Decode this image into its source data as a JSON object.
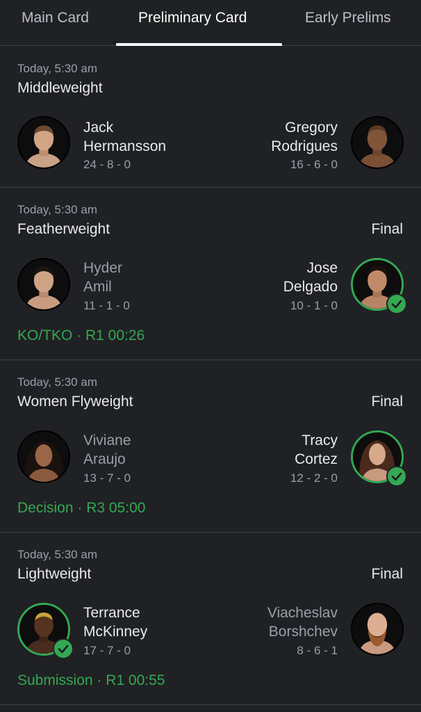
{
  "tabs": [
    {
      "label": "Main Card"
    },
    {
      "label": "Preliminary Card"
    },
    {
      "label": "Early Prelims"
    }
  ],
  "fights": [
    {
      "time": "Today, 5:30 am",
      "division": "Middleweight",
      "status": "",
      "left": {
        "first": "Jack",
        "last": "Hermansson",
        "record": "24 - 8 - 0",
        "winner": false
      },
      "right": {
        "first": "Gregory",
        "last": "Rodrigues",
        "record": "16 - 6 - 0",
        "winner": false
      },
      "result": ""
    },
    {
      "time": "Today, 5:30 am",
      "division": "Featherweight",
      "status": "Final",
      "left": {
        "first": "Hyder",
        "last": "Amil",
        "record": "11 - 1 - 0",
        "winner": false
      },
      "right": {
        "first": "Jose",
        "last": "Delgado",
        "record": "10 - 1 - 0",
        "winner": true
      },
      "result": "KO/TKO · R1 00:26"
    },
    {
      "time": "Today, 5:30 am",
      "division": "Women Flyweight",
      "status": "Final",
      "left": {
        "first": "Viviane",
        "last": "Araujo",
        "record": "13 - 7 - 0",
        "winner": false
      },
      "right": {
        "first": "Tracy",
        "last": "Cortez",
        "record": "12 - 2 - 0",
        "winner": true
      },
      "result": "Decision · R3 05:00"
    },
    {
      "time": "Today, 5:30 am",
      "division": "Lightweight",
      "status": "Final",
      "left": {
        "first": "Terrance",
        "last": "McKinney",
        "record": "17 - 7 - 0",
        "winner": true
      },
      "right": {
        "first": "Viacheslav",
        "last": "Borshchev",
        "record": "8 - 6 - 1",
        "winner": false
      },
      "result": "Submission · R1 00:55"
    }
  ],
  "colors": {
    "background": "#202124",
    "win_green": "#34a853",
    "muted_text": "#9aa0a6",
    "divider": "#3c4043"
  }
}
